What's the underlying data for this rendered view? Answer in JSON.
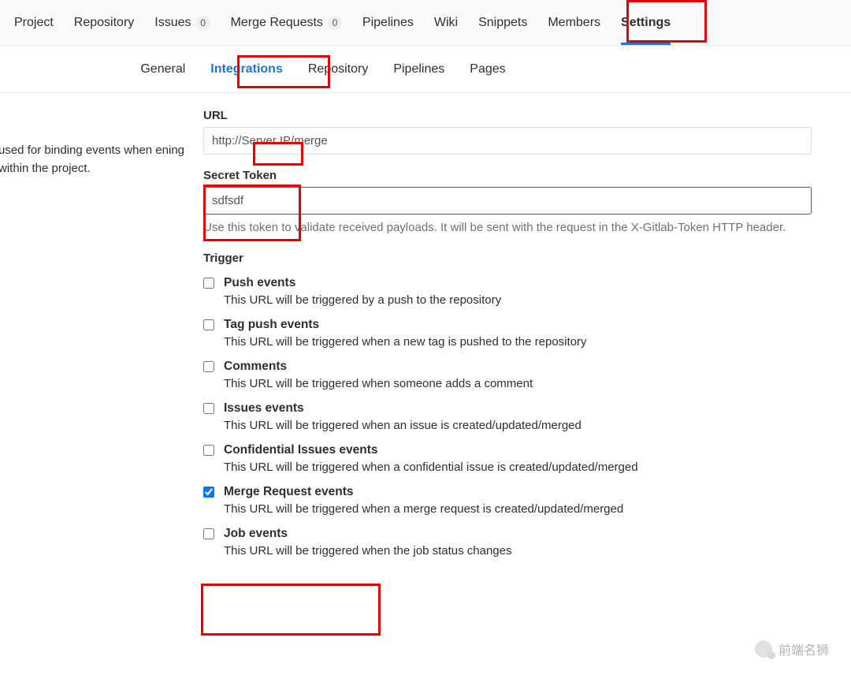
{
  "topnav": {
    "tabs": [
      {
        "label": "Project"
      },
      {
        "label": "Repository"
      },
      {
        "label": "Issues",
        "count": "0"
      },
      {
        "label": "Merge Requests",
        "count": "0"
      },
      {
        "label": "Pipelines"
      },
      {
        "label": "Wiki"
      },
      {
        "label": "Snippets"
      },
      {
        "label": "Members"
      },
      {
        "label": "Settings",
        "active": true
      }
    ]
  },
  "subnav": {
    "tabs": [
      {
        "label": "General"
      },
      {
        "label": "Integrations",
        "active": true
      },
      {
        "label": "Repository"
      },
      {
        "label": "Pipelines"
      },
      {
        "label": "Pages"
      }
    ]
  },
  "side_text": "used for binding events when ening within the project.",
  "url": {
    "label": "URL",
    "value": "http://Server IP/merge"
  },
  "secret": {
    "label": "Secret Token",
    "value": "sdfsdf",
    "help": "Use this token to validate received payloads. It will be sent with the request in the X-Gitlab-Token HTTP header."
  },
  "trigger": {
    "label": "Trigger",
    "items": [
      {
        "title": "Push events",
        "desc": "This URL will be triggered by a push to the repository",
        "checked": false
      },
      {
        "title": "Tag push events",
        "desc": "This URL will be triggered when a new tag is pushed to the repository",
        "checked": false
      },
      {
        "title": "Comments",
        "desc": "This URL will be triggered when someone adds a comment",
        "checked": false
      },
      {
        "title": "Issues events",
        "desc": "This URL will be triggered when an issue is created/updated/merged",
        "checked": false
      },
      {
        "title": "Confidential Issues events",
        "desc": "This URL will be triggered when a confidential issue is created/updated/merged",
        "checked": false
      },
      {
        "title": "Merge Request events",
        "desc": "This URL will be triggered when a merge request is created/updated/merged",
        "checked": true
      },
      {
        "title": "Job events",
        "desc": "This URL will be triggered when the job status changes",
        "checked": false
      }
    ]
  },
  "watermark": "前端名狮"
}
